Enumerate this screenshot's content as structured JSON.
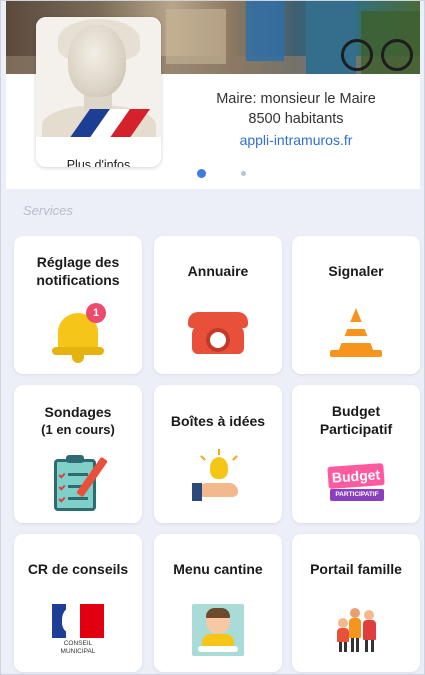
{
  "header": {
    "more_info_label": "Plus d'infos",
    "mayor": "Maire: monsieur le Maire",
    "population": "8500 habitants",
    "website": "appli-intramuros.fr",
    "carousel": {
      "active_index": 0,
      "count": 2
    }
  },
  "section": {
    "title": "Services"
  },
  "tiles": [
    {
      "label": "Réglage des notifications",
      "sub": "",
      "icon": "bell-icon",
      "badge": "1"
    },
    {
      "label": "Annuaire",
      "sub": "",
      "icon": "phone-icon"
    },
    {
      "label": "Signaler",
      "sub": "",
      "icon": "traffic-cone-icon"
    },
    {
      "label": "Sondages",
      "sub": "(1 en cours)",
      "icon": "clipboard-checklist-icon"
    },
    {
      "label": "Boîtes à idées",
      "sub": "",
      "icon": "lightbulb-hand-icon"
    },
    {
      "label": "Budget Participatif",
      "sub": "",
      "icon": "budget-participatif-icon",
      "icon_text": "Budget",
      "icon_subtext": "PARTICIPATIF"
    },
    {
      "label": "CR de conseils",
      "sub": "",
      "icon": "conseil-municipal-logo-icon",
      "icon_text": "CONSEIL MUNICIPAL"
    },
    {
      "label": "Menu cantine",
      "sub": "",
      "icon": "child-eating-icon"
    },
    {
      "label": "Portail famille",
      "sub": "",
      "icon": "family-icon"
    }
  ],
  "colors": {
    "background": "#eceff7",
    "link": "#2f6fd6",
    "dot_active": "#3e7ae0",
    "badge": "#ec4b6e"
  }
}
